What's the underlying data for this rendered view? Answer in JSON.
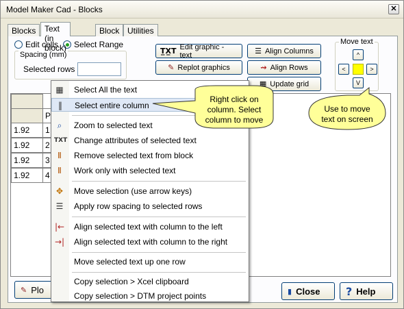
{
  "window": {
    "title": "Model Maker Cad - Blocks",
    "close_glyph": "✕"
  },
  "tabs": [
    {
      "label": "Blocks"
    },
    {
      "label": "Text (in block)"
    },
    {
      "label": "Block"
    },
    {
      "label": "Utilities"
    }
  ],
  "mode": {
    "edit_cells": "Edit cells",
    "select_range": "Select Range",
    "selected": "Select Range"
  },
  "spacing": {
    "group_title": "Spacing (mm)",
    "selected_rows_label": "Selected rows",
    "selected_rows_value": ""
  },
  "toolbar": {
    "edit_graphic": "Edit graphic - text",
    "replot_graphics": "Replot graphics",
    "align_columns": "Align Columns",
    "align_rows": "Align Rows",
    "update_grid": "Update grid"
  },
  "move_text": {
    "title": "Move text",
    "up": "^",
    "down": "V",
    "left": "<",
    "right": ">",
    "center_color": "#ffff00"
  },
  "grid": {
    "header_fragment": "P",
    "rows": [
      {
        "c1": "1.92",
        "c2": "1"
      },
      {
        "c1": "1.92",
        "c2": "2"
      },
      {
        "c1": "1.92",
        "c2": "3"
      },
      {
        "c1": "1.92",
        "c2": "4"
      }
    ]
  },
  "context_menu": {
    "items": [
      {
        "label": "Select All the text",
        "icon": "grid-icon"
      },
      {
        "label": "Select entire column",
        "icon": "column-icon",
        "highlighted": true
      },
      {
        "label": "Zoom to selected text",
        "icon": "magnifier-icon"
      },
      {
        "label": "Change attributes of selected text",
        "icon": "text-attributes-icon"
      },
      {
        "label": "Remove selected text from block",
        "icon": "remove-text-icon"
      },
      {
        "label": "Work only with selected text",
        "icon": "filter-text-icon"
      },
      {
        "label": "Move selection (use arrow keys)",
        "icon": "move-arrows-icon"
      },
      {
        "label": "Apply row spacing to selected rows",
        "icon": "row-spacing-icon"
      },
      {
        "label": "Align selected text with column to the left",
        "icon": "align-left-icon"
      },
      {
        "label": "Align selected text with column to the right",
        "icon": "align-right-icon"
      },
      {
        "label": "Move selected text up one row",
        "icon": ""
      },
      {
        "label": "Copy selection > Xcel clipboard",
        "icon": ""
      },
      {
        "label": "Copy selection > DTM project points",
        "icon": ""
      }
    ]
  },
  "callouts": {
    "column": [
      "Right click on",
      "column. Select",
      "column to move"
    ],
    "move": [
      "Use to move",
      "text on screen"
    ],
    "fill_color": "#ffff99"
  },
  "bottom": {
    "plot_fragment": "Plo",
    "close": "Close",
    "help": "Help"
  }
}
